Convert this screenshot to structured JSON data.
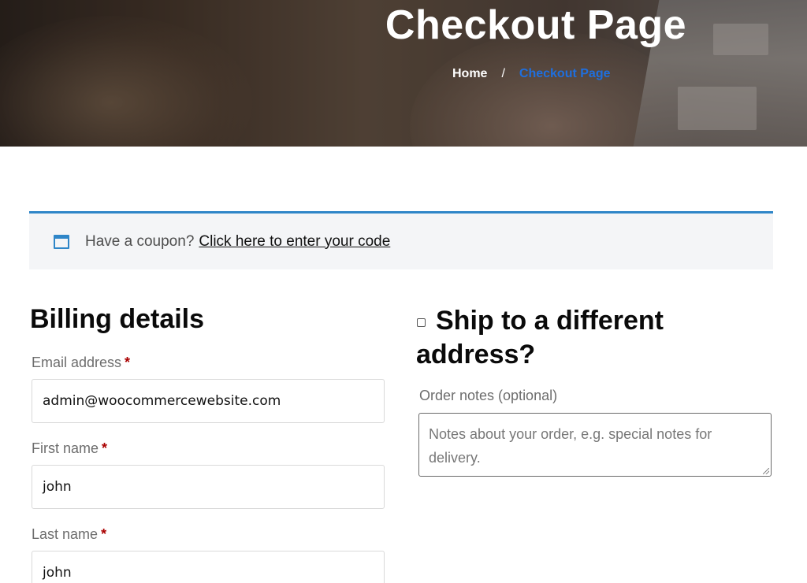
{
  "hero": {
    "title": "Checkout Page",
    "breadcrumb": {
      "home": "Home",
      "separator": "/",
      "current": "Checkout Page"
    }
  },
  "coupon": {
    "icon": "window-icon",
    "text": "Have a coupon?",
    "link": "Click here to enter your code"
  },
  "billing": {
    "heading": "Billing details",
    "required_marker": "*",
    "fields": {
      "email": {
        "label": "Email address",
        "value": "admin@woocommercewebsite.com"
      },
      "first_name": {
        "label": "First name",
        "value": "john"
      },
      "last_name": {
        "label": "Last name",
        "value": "john"
      }
    }
  },
  "shipping": {
    "heading": "Ship to a different address?",
    "checked": false
  },
  "order_notes": {
    "label": "Order notes (optional)",
    "placeholder": "Notes about your order, e.g. special notes for delivery."
  },
  "colors": {
    "accent": "#2f86c8",
    "breadcrumb_current": "#1f6fde",
    "required": "#aa0000"
  }
}
